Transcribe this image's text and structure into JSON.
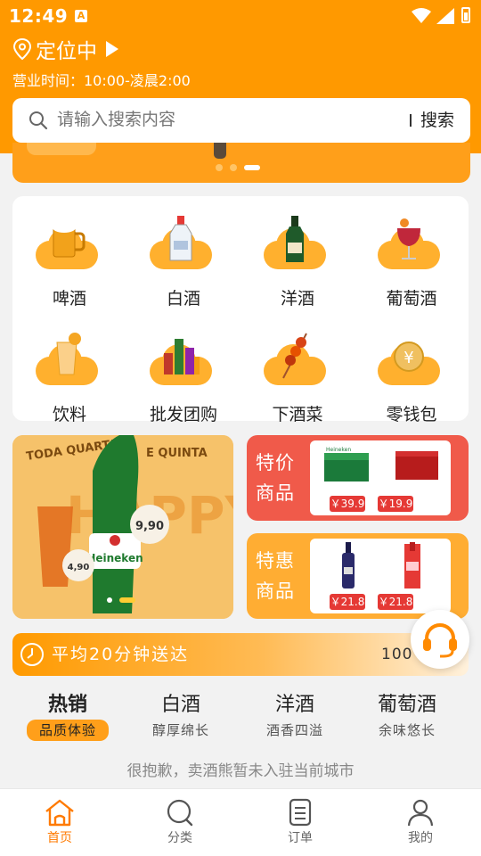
{
  "status_bar": {
    "time": "12:49",
    "badge": "A"
  },
  "header": {
    "location": "定位中",
    "hours": "营业时间：10:00-凌晨2:00"
  },
  "search": {
    "placeholder": "请输入搜索内容",
    "button": "搜索"
  },
  "categories": [
    {
      "label": "啤酒",
      "icon": "beer-mug-icon"
    },
    {
      "label": "白酒",
      "icon": "baijiu-bottle-icon"
    },
    {
      "label": "洋酒",
      "icon": "whisky-bottle-icon"
    },
    {
      "label": "葡萄酒",
      "icon": "wine-glass-icon"
    },
    {
      "label": "饮料",
      "icon": "juice-glass-icon"
    },
    {
      "label": "批发团购",
      "icon": "bottles-group-icon"
    },
    {
      "label": "下酒菜",
      "icon": "skewer-icon"
    },
    {
      "label": "零钱包",
      "icon": "coin-icon"
    }
  ],
  "promo_banner": {
    "text_top": "TODA QUARTA E QUINTA",
    "brand": "Heineken",
    "price_tag": "9,90",
    "price_tag_small": "4,90"
  },
  "special_offers": {
    "title": "特价商品",
    "items": [
      {
        "price": "￥39.9"
      },
      {
        "price": "￥19.9"
      }
    ]
  },
  "discount_offers": {
    "title": "特惠商品",
    "items": [
      {
        "price": "￥21.8"
      },
      {
        "price": "￥21.8"
      }
    ]
  },
  "delivery": {
    "text": "平均20分钟送达",
    "percent": "100"
  },
  "tabs": [
    {
      "title": "热销",
      "sub": "品质体验",
      "active": true
    },
    {
      "title": "白酒",
      "sub": "醇厚绵长",
      "active": false
    },
    {
      "title": "洋酒",
      "sub": "酒香四溢",
      "active": false
    },
    {
      "title": "葡萄酒",
      "sub": "余味悠长",
      "active": false
    }
  ],
  "empty_message": "很抱歉，卖酒熊暂未入驻当前城市",
  "bottom_nav": [
    {
      "label": "首页",
      "icon": "home-icon",
      "active": true
    },
    {
      "label": "分类",
      "icon": "search-category-icon",
      "active": false
    },
    {
      "label": "订单",
      "icon": "order-list-icon",
      "active": false
    },
    {
      "label": "我的",
      "icon": "user-icon",
      "active": false
    }
  ],
  "colors": {
    "brand": "#ff9900",
    "special": "#f05a4a",
    "discount": "#ffad33",
    "price": "#e53935",
    "nav_active": "#ff7a00"
  }
}
